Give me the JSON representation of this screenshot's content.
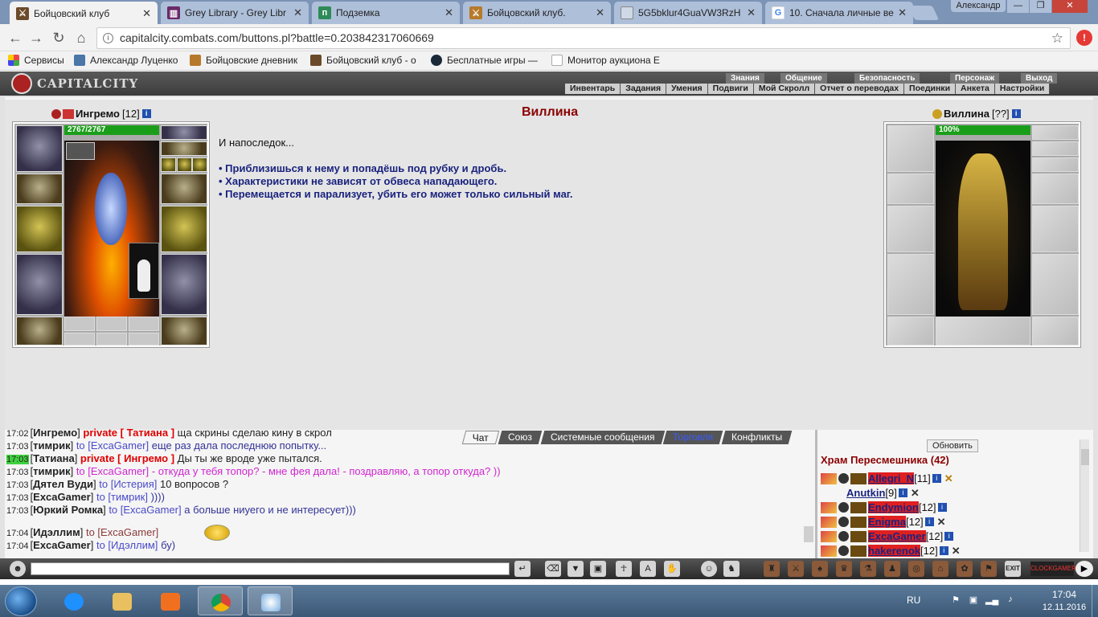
{
  "browser": {
    "tabs": [
      {
        "title": "Бойцовский клуб",
        "icon": "sword-favicon",
        "color": "#6b4a2a"
      },
      {
        "title": "Grey Library - Grey Libr",
        "icon": "library-favicon",
        "color": "#6a2a6a"
      },
      {
        "title": "Подземка",
        "icon": "p-favicon",
        "color": "#2e8b57"
      },
      {
        "title": "Бойцовский клуб.",
        "icon": "sword-favicon",
        "color": "#b77a2a"
      },
      {
        "title": "5G5bklur4GuaVW3RzH",
        "icon": "page-favicon",
        "color": "#cfd8e6"
      },
      {
        "title": "10. Сначала личные ве",
        "icon": "google-favicon",
        "color": "#4285f4"
      }
    ],
    "user_badge": "Александр",
    "url": "capitalcity.combats.com/buttons.pl?battle=0.203842317060669",
    "bookmarks": [
      {
        "label": "Сервисы",
        "icon": "apps-icon",
        "color": "#e44"
      },
      {
        "label": "Александр Луценко",
        "icon": "vk-icon",
        "color": "#4a76a8"
      },
      {
        "label": "Бойцовские дневник",
        "icon": "sword-icon",
        "color": "#b77a2a"
      },
      {
        "label": "Бойцовский клуб - о",
        "icon": "sword-icon",
        "color": "#6b4a2a"
      },
      {
        "label": "Бесплатные игры —",
        "icon": "steam-icon",
        "color": "#1b2838"
      },
      {
        "label": "Монитор аукциона Е",
        "icon": "page-icon",
        "color": "#dddddd"
      }
    ]
  },
  "game": {
    "logo": "CAPITALCITY",
    "top_menu": [
      "Знания",
      "Общение",
      "Безопасность",
      "Персонаж",
      "Выход"
    ],
    "sub_menu": [
      "Инвентарь",
      "Задания",
      "Умения",
      "Подвиги",
      "Мой Скролл",
      "Отчет о переводах",
      "Поединки",
      "Анкета",
      "Настройки"
    ],
    "battle_title": "Виллина",
    "player": {
      "name": "Ингремо",
      "level": "[12]",
      "hp": "2767/2767"
    },
    "enemy": {
      "name": "Виллина",
      "level": "[??]",
      "hp": "100%"
    },
    "intro": "И напоследок...",
    "bullets": [
      "• Приблизишься к нему и попадёшь под рубку и дробь.",
      "• Характеристики не зависят от обвеса нападающего.",
      "• Перемещается и парализует, убить его может только сильный маг."
    ],
    "info_glyph": "i"
  },
  "chat": {
    "tabs": [
      "Чат",
      "Союз",
      "Системные сообщения",
      "Торговля",
      "Конфликты"
    ],
    "lines": [
      {
        "time": "17:02",
        "who": "Ингремо",
        "pv": "private [ Татиана ]",
        "msg": "ща скрины сделаю кину в скрол",
        "style": "msg"
      },
      {
        "time": "17:03",
        "who": "тимрик",
        "to": "to [ExcaGamer]",
        "msg": "еще раз дала последнюю попытку...",
        "style": "navy"
      },
      {
        "time": "17:03",
        "who": "Татиана",
        "pv": "private [ Ингремо ]",
        "msg": "Ды ты же вроде уже пытался.",
        "style": "msg",
        "hl": true
      },
      {
        "time": "17:03",
        "who": "тимрик",
        "to": "to [ExcaGamer]",
        "msg": "- откуда у тебя топор? - мне фея дала! - поздравляю, а топор откуда? ))",
        "style": "pink"
      },
      {
        "time": "17:03",
        "who": "Дятел Вуди",
        "to": "to [Истерия]",
        "msg": "10 вопросов ?",
        "style": "msg"
      },
      {
        "time": "17:03",
        "who": "ExcaGamer",
        "to": "to [тимрик]",
        "msg": "))))",
        "style": "navy"
      },
      {
        "time": "17:03",
        "who": "Юркий Ромка",
        "to": "to [ExcaGamer]",
        "msg": "а больше ниуего и не интересует)))",
        "style": "navy"
      },
      {
        "time": "17:04",
        "who": "Идэллим",
        "to": "to [ExcaGamer]",
        "msg": "",
        "style": "brick"
      },
      {
        "time": "17:04",
        "who": "ExcaGamer",
        "to": "to [Идэллим]",
        "msg": "бу)",
        "style": "navy"
      }
    ]
  },
  "online": {
    "refresh_label": "Обновить",
    "room": "Храм Пересмешника (42)",
    "users": [
      {
        "name": "Allegri_N",
        "level": "[11]",
        "red": true,
        "kx": "gold"
      },
      {
        "name": "Anutkin",
        "level": "[9]",
        "red": false,
        "kx": "dark"
      },
      {
        "name": "Endymion",
        "level": "[12]",
        "red": true,
        "kx": ""
      },
      {
        "name": "Enigma",
        "level": "[12]",
        "red": true,
        "kx": "dark"
      },
      {
        "name": "ExcaGamer",
        "level": "[12]",
        "red": true,
        "kx": ""
      },
      {
        "name": "hakerenok",
        "level": "[12]",
        "red": true,
        "kx": "dark"
      }
    ]
  },
  "inputbar": {
    "exit_label": "EXIT",
    "clock_label": "CLOCKGAMER"
  },
  "taskbar": {
    "lang": "RU",
    "time": "17:04",
    "date": "12.11.2016"
  }
}
